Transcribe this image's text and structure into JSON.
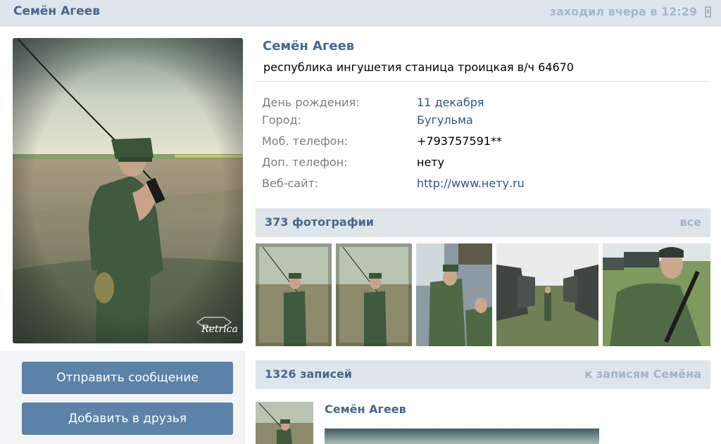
{
  "header": {
    "name": "Семён Агеев",
    "last_seen": "заходил вчера в 12:29",
    "device_icon": "mobile-phone-icon"
  },
  "profile": {
    "name": "Семён Агеев",
    "status": "республика ингушетия станица троицкая в/ч 64670",
    "avatar_watermark": "Retrica"
  },
  "info": [
    {
      "label": "День рождения:",
      "value": "11 декабря"
    },
    {
      "label": "Город:",
      "value": "Бугульма"
    },
    {
      "label": "Моб. телефон:",
      "value": "+793757591**"
    },
    {
      "label": "Доп. телефон:",
      "value": "нету"
    },
    {
      "label": "Веб-сайт:",
      "value": "http://www.нету.ru"
    }
  ],
  "actions": {
    "send_message": "Отправить сообщение",
    "add_friend": "Добавить в друзья"
  },
  "photos": {
    "title": "373 фотографии",
    "all_link": "все",
    "items": [
      "photo-radio-field",
      "photo-radio-field-2",
      "photo-soldiers-vehicle",
      "photo-military-trucks",
      "photo-soldier-rifle"
    ]
  },
  "wall": {
    "title": "1326 записей",
    "link": "к записям Семёна",
    "post_author": "Семён Агеев"
  },
  "colors": {
    "header_bg": "#dee5eb",
    "link_blue": "#45688e",
    "button_blue": "#5d82a8",
    "muted": "#a7b6c6"
  }
}
